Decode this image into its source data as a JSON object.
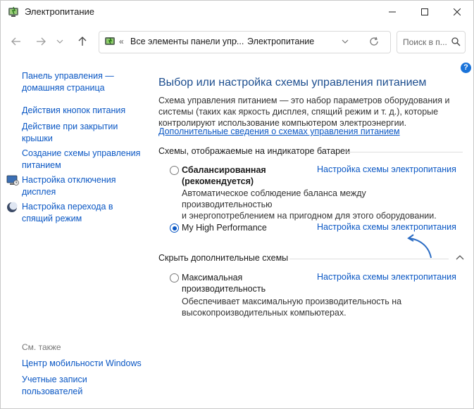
{
  "window": {
    "title": "Электропитание"
  },
  "address_bar": {
    "overflow_marker": "«",
    "crumb_parent": "Все элементы панели упр...",
    "crumb_current": "Электропитание",
    "separator": "›"
  },
  "search": {
    "placeholder": "Поиск в п..."
  },
  "help_label": "?",
  "sidebar": {
    "home_link": "Панель управления — домашняя страница",
    "home_line1": "Панель управления —",
    "home_line2": "домашняя страница",
    "items": [
      {
        "line1": "Действия кнопок питания",
        "line2": ""
      },
      {
        "line1": "Действие при закрытии",
        "line2": "крышки"
      },
      {
        "line1": "Создание схемы управления",
        "line2": "питанием"
      },
      {
        "line1": "Настройка отключения",
        "line2": "дисплея",
        "icon": "monitor-icon"
      },
      {
        "line1": "Настройка перехода в",
        "line2": "спящий режим",
        "icon": "moon-icon"
      }
    ],
    "see_also_label": "См. также",
    "see_also": [
      {
        "line1": "Центр мобильности Windows",
        "line2": ""
      },
      {
        "line1": "Учетные записи",
        "line2": "пользователей"
      }
    ]
  },
  "main": {
    "heading": "Выбор или настройка схемы управления питанием",
    "description_line1": "Схема управления питанием — это набор параметров оборудования и",
    "description_line2": "системы (таких как яркость дисплея, спящий режим и т. д.), которые",
    "description_line3": "контролируют использование компьютером электроэнергии.",
    "more_info_link": "Дополнительные сведения о схемах управления питанием",
    "battery_group_label": "Схемы, отображаемые на индикаторе батареи",
    "hidden_group_label": "Скрыть дополнительные схемы",
    "settings_link_label": "Настройка схемы электропитания",
    "plans": [
      {
        "name_line1": "Сбалансированная",
        "name_line2": "(рекомендуется)",
        "selected": false,
        "bold": true,
        "desc_line1": "Автоматическое соблюдение баланса между производительностью",
        "desc_line2": "и энергопотреблением на пригодном для этого оборудовании."
      },
      {
        "name_line1": "My High Performance",
        "name_line2": "",
        "selected": true,
        "bold": false,
        "desc_line1": "",
        "desc_line2": ""
      }
    ],
    "hidden_plans": [
      {
        "name_line1": "Максимальная",
        "name_line2": "производительность",
        "selected": false,
        "desc_line1": "Обеспечивает максимальную производительность на",
        "desc_line2": "высокопроизводительных компьютерах."
      }
    ]
  },
  "colors": {
    "link": "#0a57c4",
    "heading": "#1d4e8f",
    "annotation_arrow": "#2b6cc4"
  }
}
